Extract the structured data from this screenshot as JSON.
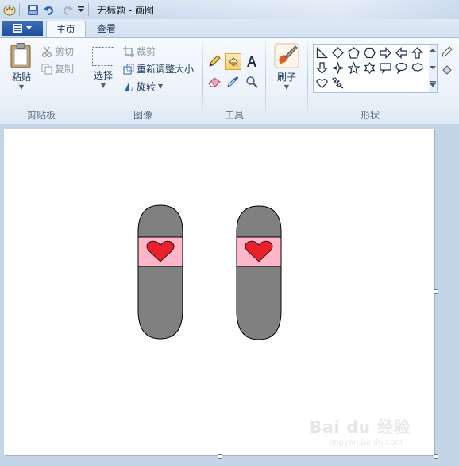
{
  "window": {
    "title": "无标题 - 画图"
  },
  "tabs": {
    "home": "主页",
    "view": "查看"
  },
  "clipboard": {
    "group_label": "剪贴板",
    "paste": "粘贴",
    "cut": "剪切",
    "copy": "复制"
  },
  "image": {
    "group_label": "图像",
    "select": "选择",
    "crop": "裁剪",
    "resize": "重新调整大小",
    "rotate": "旋转"
  },
  "tools": {
    "group_label": "工具",
    "items": [
      "pencil-icon",
      "fill-icon",
      "text-icon",
      "eraser-icon",
      "color-picker-icon",
      "magnifier-icon"
    ],
    "selected": "fill-icon"
  },
  "brushes": {
    "label": "刷子"
  },
  "shapes": {
    "group_label": "形状",
    "items": [
      "right-triangle",
      "diamond",
      "pentagon",
      "hexagon",
      "right-arrow",
      "left-arrow",
      "up-arrow",
      "down-arrow",
      "four-point-star",
      "five-point-star",
      "six-point-star",
      "rounded-callout",
      "oval-callout",
      "cloud-callout",
      "heart",
      "lightning"
    ]
  },
  "canvas": {
    "background": "#ffffff",
    "drawing": {
      "capsule_fill": "#808080",
      "band_fill": "#ffb6c8",
      "heart_fill": "#e8212b"
    }
  },
  "colors": {
    "ribbon_bg": "#eef4fb",
    "workarea_bg": "#c5d5e8",
    "file_button": "#2a5aa8"
  },
  "watermark": {
    "text": "Bai du 经验",
    "sub": "jingyan.baidu.com"
  }
}
